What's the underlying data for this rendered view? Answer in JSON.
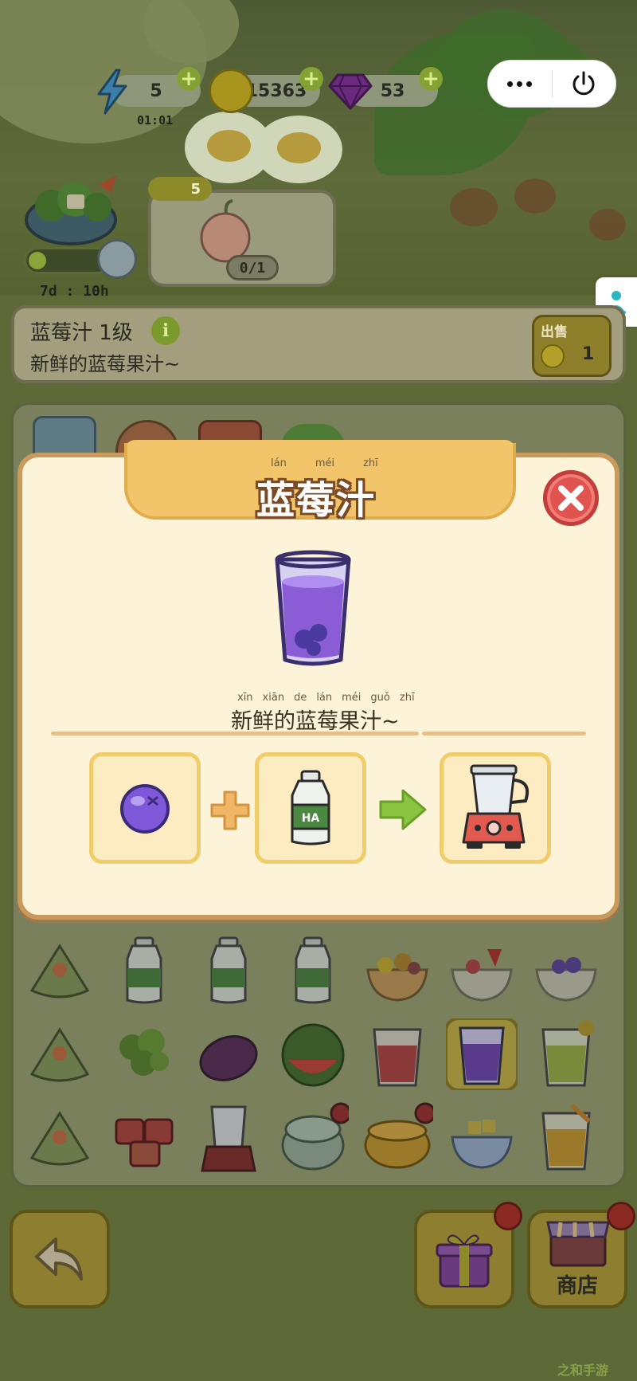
{
  "resources": {
    "energy": {
      "value": "5",
      "timer": "01:01"
    },
    "coins": {
      "value": "15363"
    },
    "gems": {
      "value": "53"
    },
    "plus_symbol": "+"
  },
  "capsule": {
    "more_icon": "more-dots-icon",
    "close_icon": "power-icon"
  },
  "order": {
    "time_left": "7d : 10h",
    "badge_count": "5",
    "progress": "0/1"
  },
  "info_bar": {
    "title": "蓝莓汁 1级",
    "description": "新鲜的蓝莓果汁~",
    "info_symbol": "i",
    "sell_label": "出售",
    "sell_price": "1"
  },
  "modal": {
    "title": "蓝莓汁",
    "title_pinyin": [
      "lán",
      "méi",
      "zhī"
    ],
    "description": "新鲜的蓝莓果汁~",
    "description_pinyin": [
      "xīn",
      "xiān",
      "de",
      "lán",
      "méi",
      "guǒ",
      "zhī"
    ],
    "recipe": {
      "ingredients": [
        "blueberry",
        "water-bottle"
      ],
      "tool": "blender"
    },
    "bottle_label": "HA"
  },
  "board_items": [
    [
      "rice-ball",
      "water-bottle",
      "water-bottle",
      "water-bottle",
      "fruit-bowl",
      "strawberry-bowl",
      "blueberry-bowl"
    ],
    [
      "rice-ball",
      "parsley",
      "purple-sweet-potato",
      "watermelon",
      "red-juice",
      "blueberry-juice",
      "green-juice"
    ],
    [
      "rice-ball",
      "meat-cubes",
      "blender",
      "rice-cooker",
      "cooking-pot",
      "mango-bowl",
      "orange-juice"
    ]
  ],
  "bottom_nav": {
    "shop_label": "商店"
  },
  "watermark": "之和手游",
  "colors": {
    "modal_bg": "#fdf3d8",
    "modal_border": "#c99a5e",
    "header_bg": "#f2c56b",
    "close_red": "#e0534f",
    "slot_border": "#f0cd6a",
    "arrow_green": "#8bc440",
    "plus_orange": "#f0b866",
    "juice_purple": "#8a5cd6"
  }
}
